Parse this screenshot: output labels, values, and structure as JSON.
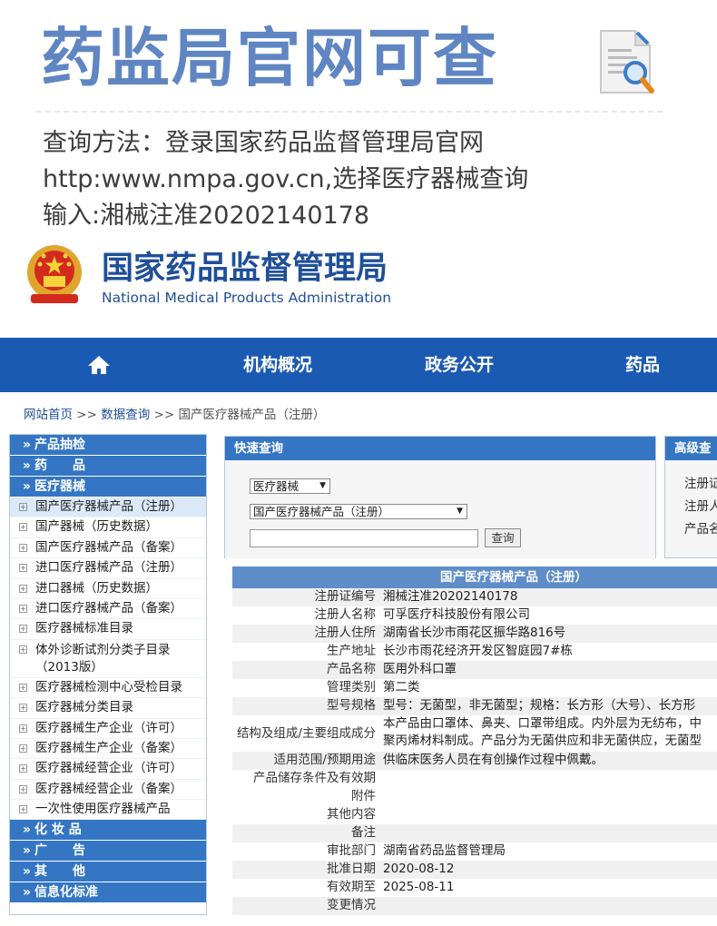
{
  "header": {
    "title": "药监局官网可查",
    "note_line1": "查询方法：登录国家药品监督管理局官网",
    "note_line2": "http:www.nmpa.gov.cn,选择医疗器械查询",
    "note_line3": "输入:湘械注准20202140178"
  },
  "brand": {
    "cn": "国家药品监督管理局",
    "en": "National Medical Products Administration"
  },
  "colors": {
    "title": "#5f86c2",
    "brand": "#1f4f99",
    "nav": "#1b5ab3",
    "panel": "#3476c4"
  },
  "nav": {
    "home_icon": "home-icon",
    "items": [
      "机构概况",
      "政务公开",
      "药品"
    ]
  },
  "breadcrumb": {
    "home": "网站首页",
    "sep1": ">>",
    "data": "数据查询",
    "sep2": ">>",
    "current": "国产医疗器械产品（注册）"
  },
  "sidebar": {
    "cat1": "产品抽检",
    "cat2": "药　　品",
    "cat3": "医疗器械",
    "items": [
      "国产医疗器械产品（注册）",
      "国产器械（历史数据）",
      "国产医疗器械产品（备案）",
      "进口医疗器械产品（注册）",
      "进口器械（历史数据）",
      "进口医疗器械产品（备案）",
      "医疗器械标准目录",
      "体外诊断试剂分类子目录（2013版）",
      "医疗器械检测中心受检目录",
      "医疗器械分类目录",
      "医疗器械生产企业（许可）",
      "医疗器械生产企业（备案）",
      "医疗器械经营企业（许可）",
      "医疗器械经营企业（备案）",
      "一次性使用医疗器械产品"
    ],
    "cat4": "化 妆 品",
    "cat5": "广　　告",
    "cat6": "其　　他",
    "cat7": "信息化标准"
  },
  "quick": {
    "title": "快速查询",
    "select1": "医疗器械",
    "select2": "国产医疗器械产品（注册）",
    "input_value": "",
    "button": "查询"
  },
  "advanced": {
    "title": "高级查",
    "fields": [
      "注册证",
      "注册人",
      "产品名"
    ]
  },
  "detail": {
    "title": "国产医疗器械产品（注册）",
    "rows": [
      {
        "k": "注册证编号",
        "v": "湘械注准20202140178"
      },
      {
        "k": "注册人名称",
        "v": "可孚医疗科技股份有限公司"
      },
      {
        "k": "注册人住所",
        "v": "湖南省长沙市雨花区振华路816号"
      },
      {
        "k": "生产地址",
        "v": "长沙市雨花经济开发区智庭园7#栋"
      },
      {
        "k": "产品名称",
        "v": "医用外科口罩"
      },
      {
        "k": "管理类别",
        "v": "第二类"
      },
      {
        "k": "型号规格",
        "v": "型号：无菌型，非无菌型；规格：长方形（大号）、长方形"
      },
      {
        "k": "结构及组成/主要组成成分",
        "v": "本产品由口罩体、鼻夹、口罩带组成。内外层为无纺布，中",
        "v2": "聚丙烯材料制成。产品分为无菌供应和非无菌供应，无菌型"
      },
      {
        "k": "适用范围/预期用途",
        "v": "供临床医务人员在有创操作过程中佩戴。"
      },
      {
        "k": "产品储存条件及有效期",
        "v": ""
      },
      {
        "k": "附件",
        "v": ""
      },
      {
        "k": "其他内容",
        "v": ""
      },
      {
        "k": "备注",
        "v": ""
      },
      {
        "k": "审批部门",
        "v": "湖南省药品监督管理局"
      },
      {
        "k": "批准日期",
        "v": "2020-08-12"
      },
      {
        "k": "有效期至",
        "v": "2025-08-11"
      },
      {
        "k": "变更情况",
        "v": ""
      }
    ]
  }
}
